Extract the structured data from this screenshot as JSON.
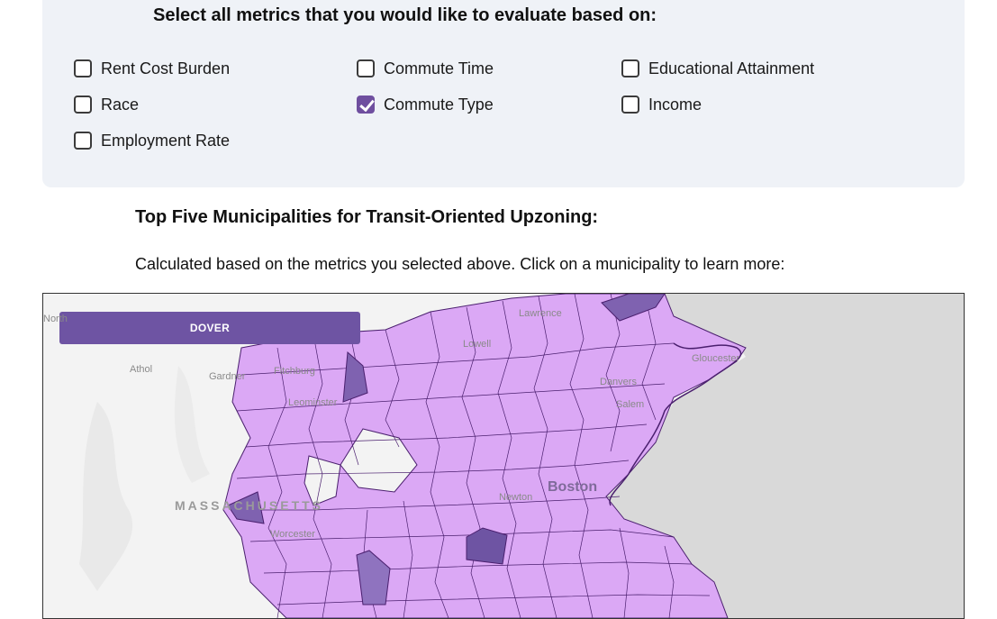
{
  "metrics": {
    "title": "Select all metrics that you would like to evaluate based on:",
    "options": [
      {
        "label": "Rent Cost Burden",
        "checked": false
      },
      {
        "label": "Commute Time",
        "checked": false
      },
      {
        "label": "Educational Attainment",
        "checked": false
      },
      {
        "label": "Race",
        "checked": false
      },
      {
        "label": "Commute Type",
        "checked": true
      },
      {
        "label": "Income",
        "checked": false
      },
      {
        "label": "Employment Rate",
        "checked": false
      }
    ]
  },
  "results": {
    "heading": "Top Five Municipalities for Transit-Oriented Upzoning:",
    "subtitle": "Calculated based on the metrics you selected above. Click on a municipality to learn more:"
  },
  "map": {
    "selected_label": "DOVER",
    "place_labels": {
      "athol": "Athol",
      "gardner": "Gardner",
      "fitchburg": "Fitchburg",
      "leominster": "Leominster",
      "lowell": "Lowell",
      "lawrence": "Lawrence",
      "danvers": "Danvers",
      "salem": "Salem",
      "newton": "Newton",
      "boston": "Boston",
      "worcester": "Worcester",
      "massachusetts": "MASSACHUSETTS",
      "gloucester": "Gloucester",
      "north": "North"
    },
    "colors": {
      "municipality_fill": "#dba8f5",
      "highlight_fill": "#7f62b0",
      "border": "#4a1f6e",
      "ocean": "#d9d9d9",
      "land_base": "#f3f3f3"
    }
  }
}
